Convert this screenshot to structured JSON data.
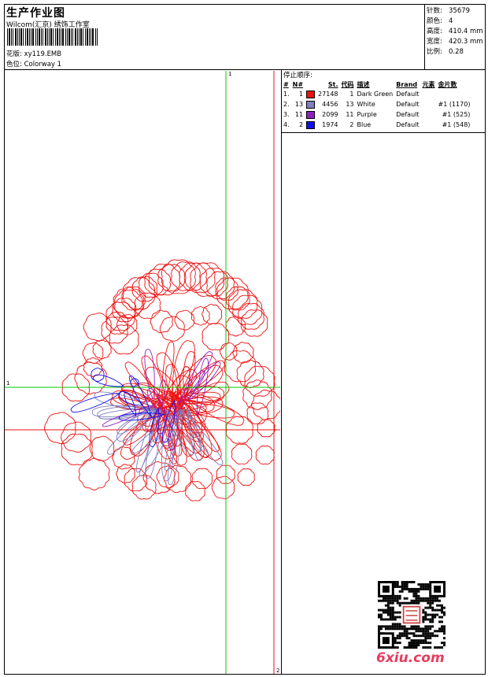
{
  "header": {
    "title": "生产作业图",
    "company": "Wilcom(汇京) 绣饰工作室",
    "design_label": "花版:",
    "design_value": "xy119.EMB",
    "colorway_label": "色位:",
    "colorway_value": "Colorway 1"
  },
  "stats": [
    {
      "label": "针数:",
      "value": "35679"
    },
    {
      "label": "颜色:",
      "value": "4"
    },
    {
      "label": "高度:",
      "value": "410.4 mm"
    },
    {
      "label": "宽度:",
      "value": "420.3 mm"
    },
    {
      "label": "比例:",
      "value": "0.28"
    }
  ],
  "stop_sequence": {
    "title": "停止顺序:",
    "headers": [
      "#",
      "N#",
      "St.",
      "代码",
      "描述",
      "Brand",
      "元素",
      "金片数"
    ],
    "rows": [
      {
        "num": "1.",
        "n": "1",
        "color": "#ee1111",
        "st": "27148",
        "code": "1",
        "desc": "Dark Green",
        "brand": "Default",
        "elem": "",
        "seq": ""
      },
      {
        "num": "2.",
        "n": "13",
        "color": "#8080c0",
        "st": "4456",
        "code": "13",
        "desc": "White",
        "brand": "Default",
        "elem": "",
        "seq": "#1 (1170)"
      },
      {
        "num": "3.",
        "n": "11",
        "color": "#9020c0",
        "st": "2099",
        "code": "11",
        "desc": "Purple",
        "brand": "Default",
        "elem": "",
        "seq": "#1 (525)"
      },
      {
        "num": "4.",
        "n": "2",
        "color": "#1010ee",
        "st": "1974",
        "code": "2",
        "desc": "Blue",
        "brand": "Default",
        "elem": "",
        "seq": "#1 (548)"
      }
    ]
  },
  "guides": {
    "v_top": "1",
    "h_left": "1",
    "v_bottom": "2"
  },
  "watermark": "6xiu.com",
  "colors": {
    "red": "#ee1111",
    "lavender": "#8080c0",
    "purple": "#9020c0",
    "blue": "#1010ee",
    "green": "#00cc00",
    "accent": "#e83c5c"
  }
}
